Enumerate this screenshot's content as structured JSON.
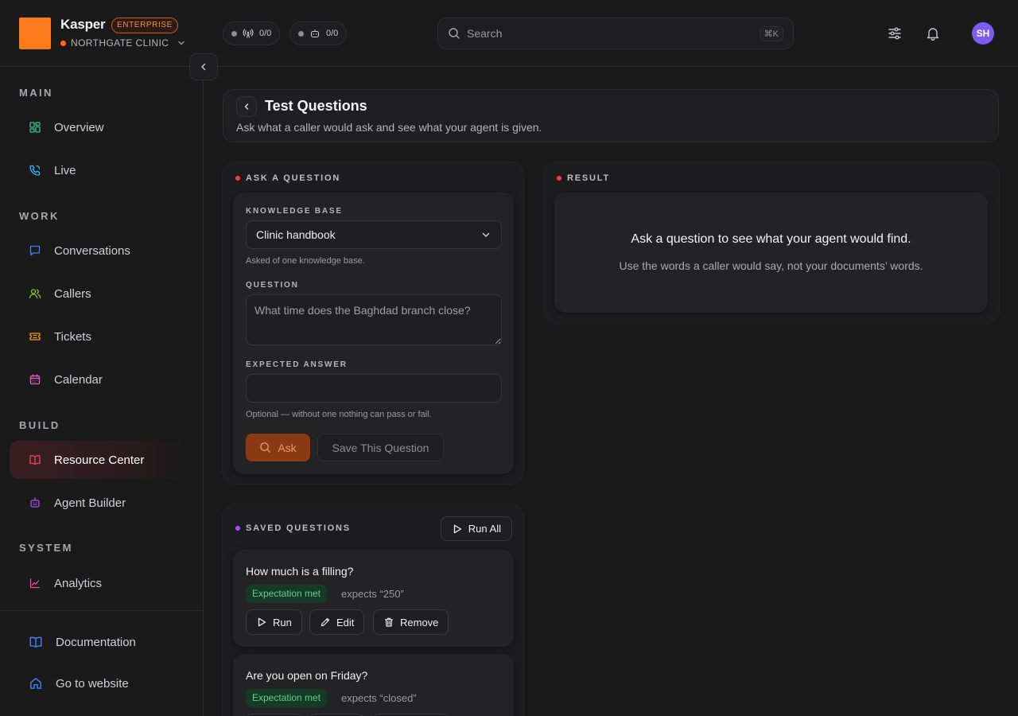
{
  "brand": {
    "name": "Kasper",
    "plan": "ENTERPRISE",
    "org": "NORTHGATE CLINIC"
  },
  "stats": [
    {
      "icon": "broadcast-icon",
      "value": "0/0"
    },
    {
      "icon": "robot-icon",
      "value": "0/0"
    }
  ],
  "search": {
    "placeholder": "Search",
    "shortcut": "⌘K"
  },
  "user": {
    "initials": "SH"
  },
  "sidebar": {
    "sections": {
      "main": "MAIN",
      "work": "WORK",
      "build": "BUILD",
      "system": "SYSTEM"
    },
    "items": {
      "overview": "Overview",
      "live": "Live",
      "conversations": "Conversations",
      "callers": "Callers",
      "tickets": "Tickets",
      "calendar": "Calendar",
      "resource_center": "Resource Center",
      "agent_builder": "Agent Builder",
      "analytics": "Analytics"
    },
    "footer": {
      "documentation": "Documentation",
      "website": "Go to website"
    }
  },
  "page": {
    "title": "Test Questions",
    "subtitle": "Ask what a caller would ask and see what your agent is given."
  },
  "ask_panel": {
    "label": "ASK A QUESTION",
    "kb_label": "KNOWLEDGE BASE",
    "kb_value": "Clinic handbook",
    "kb_hint": "Asked of one knowledge base.",
    "question_label": "QUESTION",
    "question_placeholder": "What time does the Baghdad branch close?",
    "expected_label": "EXPECTED ANSWER",
    "expected_value": "",
    "expected_hint": "Optional — without one nothing can pass or fail.",
    "ask_button": "Ask",
    "save_button": "Save This Question"
  },
  "result_panel": {
    "label": "RESULT",
    "title": "Ask a question to see what your agent would find.",
    "subtitle": "Use the words a caller would say, not your documents’ words."
  },
  "saved_panel": {
    "label": "SAVED QUESTIONS",
    "run_all": "Run All",
    "questions": [
      {
        "text": "How much is a filling?",
        "status": "Expectation met",
        "expects": "expects “250”"
      },
      {
        "text": "Are you open on Friday?",
        "status": "Expectation met",
        "expects": "expects “closed”"
      }
    ],
    "actions": {
      "run": "Run",
      "edit": "Edit",
      "remove": "Remove"
    }
  },
  "colors": {
    "accent": "#ff7a1a",
    "ask_dot": "#ff3b3b",
    "saved_dot": "#b04cff",
    "success_bg": "#163a26",
    "success_text": "#5fd08a"
  }
}
